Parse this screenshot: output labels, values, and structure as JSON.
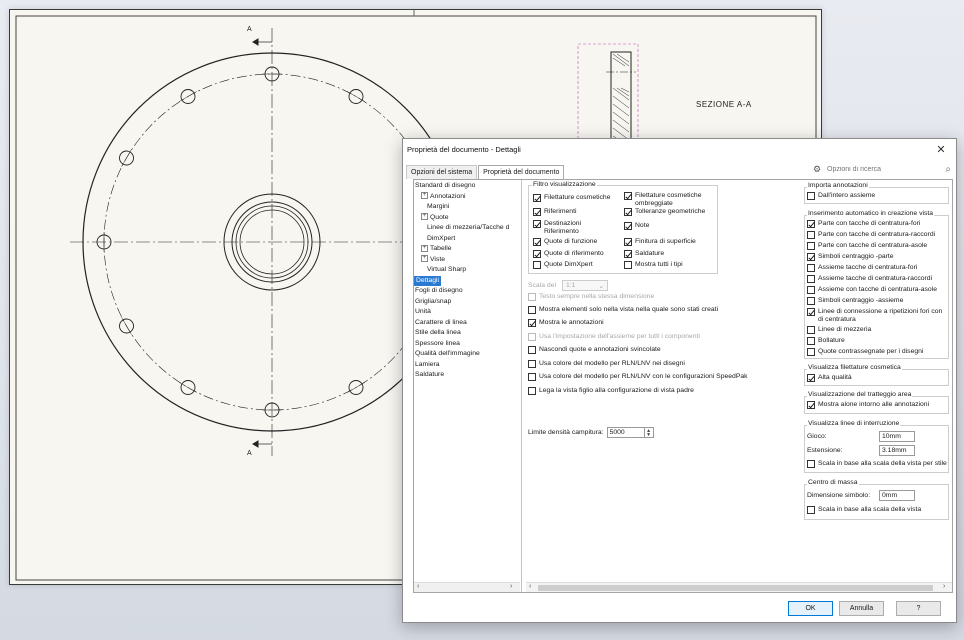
{
  "drawing": {
    "section_title": "SEZIONE A-A",
    "marker_top": "A",
    "marker_bottom": "A"
  },
  "dialog": {
    "title": "Proprietà del documento - Dettagli",
    "tabs": [
      "Opzioni del sistema",
      "Proprietà del documento"
    ],
    "search_placeholder": "Opzioni di ricerca",
    "tree": [
      {
        "label": "Standard di disegno",
        "indent": 0,
        "exp": ""
      },
      {
        "label": "Annotazioni",
        "indent": 1,
        "exp": "+"
      },
      {
        "label": "Margini",
        "indent": 2,
        "exp": ""
      },
      {
        "label": "Quote",
        "indent": 1,
        "exp": "+"
      },
      {
        "label": "Linee di mezzeria/Tacche d",
        "indent": 2,
        "exp": ""
      },
      {
        "label": "DimXpert",
        "indent": 2,
        "exp": ""
      },
      {
        "label": "Tabelle",
        "indent": 1,
        "exp": "+"
      },
      {
        "label": "Viste",
        "indent": 1,
        "exp": "+"
      },
      {
        "label": "Virtual Sharp",
        "indent": 2,
        "exp": ""
      },
      {
        "label": "Dettagli",
        "indent": 0,
        "exp": "",
        "selected": true
      },
      {
        "label": "Fogli di disegno",
        "indent": 0,
        "exp": ""
      },
      {
        "label": "Griglia/snap",
        "indent": 0,
        "exp": ""
      },
      {
        "label": "Unità",
        "indent": 0,
        "exp": ""
      },
      {
        "label": "Carattere di linea",
        "indent": 0,
        "exp": ""
      },
      {
        "label": "Stile della linea",
        "indent": 0,
        "exp": ""
      },
      {
        "label": "Spessore linea",
        "indent": 0,
        "exp": ""
      },
      {
        "label": "Qualità dell'immagine",
        "indent": 0,
        "exp": ""
      },
      {
        "label": "Lamiera",
        "indent": 0,
        "exp": ""
      },
      {
        "label": "Saldature",
        "indent": 0,
        "exp": ""
      }
    ],
    "filter_group": {
      "title": "Filtro visualizzazione",
      "left": [
        {
          "label": "Filettature cosmetiche",
          "checked": true
        },
        {
          "label": "Riferimenti",
          "checked": true
        },
        {
          "label": "Destinazioni\nRiferimento",
          "checked": true
        },
        {
          "label": "Quote di funzione",
          "checked": true
        },
        {
          "label": "Quote di riferimento",
          "checked": true
        },
        {
          "label": "Quote DimXpert",
          "checked": false
        }
      ],
      "right": [
        {
          "label": "Filettature cosmetiche\nombreggiate",
          "checked": true
        },
        {
          "label": "Tolleranze geometriche",
          "checked": true
        },
        {
          "label": "Note",
          "checked": true
        },
        {
          "label": "Finitura di superficie",
          "checked": true
        },
        {
          "label": "Saldature",
          "checked": true
        },
        {
          "label": "Mostra tutti i tipi",
          "checked": false
        }
      ]
    },
    "scale_label": "Scala del",
    "scale_value": "1:1",
    "options": [
      {
        "label": "Testo sempre nella stessa dimensione",
        "checked": false,
        "disabled": true
      },
      {
        "label": "Mostra elementi solo nella vista nella quale sono stati creati",
        "checked": false,
        "disabled": false
      },
      {
        "label": "Mostra le annotazioni",
        "checked": true,
        "disabled": false
      },
      {
        "label": "Usa l'impostazione dell'assieme per tutti i componenti",
        "checked": false,
        "disabled": true
      },
      {
        "label": "Nascondi quote e annotazioni svincolate",
        "checked": false,
        "disabled": false
      },
      {
        "label": "Usa colore del modello per RLN/LNV nei disegni",
        "checked": false,
        "disabled": false
      },
      {
        "label": "Usa colore del modello per RLN/LNV con le configurazioni SpeedPak",
        "checked": false,
        "disabled": false
      },
      {
        "label": "Lega la vista figlio alla configurazione di vista padre",
        "checked": false,
        "disabled": false
      }
    ],
    "hatch_limit_label": "Limite densità campitura:",
    "hatch_limit_value": "5000",
    "import_group": {
      "title": "Importa annotazioni",
      "items": [
        {
          "label": "Dall'intero assieme",
          "checked": false
        }
      ]
    },
    "auto_insert_group": {
      "title": "Inserimento automatico in creazione vista",
      "items": [
        {
          "label": "Parte con tacche di centratura-fori",
          "checked": true
        },
        {
          "label": "Parte con tacche di centratura-raccordi",
          "checked": false
        },
        {
          "label": "Parte con tacche di centratura-asole",
          "checked": false
        },
        {
          "label": "Simboli centraggio -parte",
          "checked": true
        },
        {
          "label": "Assieme tacche di centratura-fori",
          "checked": false
        },
        {
          "label": "Assieme tacche di centratura-raccordi",
          "checked": false
        },
        {
          "label": "Assieme con tacche di centratura-asole",
          "checked": false
        },
        {
          "label": "Simboli centraggio -assieme",
          "checked": false
        },
        {
          "label": "Linee di connessione a ripetizioni fori con\ndi centratura",
          "checked": true
        },
        {
          "label": "Linee di mezzeria",
          "checked": false
        },
        {
          "label": "Bollature",
          "checked": false
        },
        {
          "label": "Quote contrassegnate per i disegni",
          "checked": false
        }
      ]
    },
    "cosmetic_group": {
      "title": "Visualizza filettature cosmetica",
      "items": [
        {
          "label": "Alta qualità",
          "checked": true
        }
      ]
    },
    "hatch_group": {
      "title": "Visualizzazione del tratteggio area",
      "items": [
        {
          "label": "Mostra alone intorno alle annotazioni",
          "checked": true
        }
      ]
    },
    "break_group": {
      "title": "Visualizza linee di interruzione",
      "gap_label": "Gioco:",
      "gap_value": "10mm",
      "extension_label": "Estensione:",
      "extension_value": "3.18mm",
      "scale_item": {
        "label": "Scala in base alla scala della vista per stile",
        "checked": false
      }
    },
    "mass_group": {
      "title": "Centro di massa",
      "symbol_label": "Dimensione simbolo:",
      "symbol_value": "0mm",
      "scale_item": {
        "label": "Scala in base alla scala della vista",
        "checked": false
      }
    },
    "buttons": {
      "ok": "OK",
      "cancel": "Annulla",
      "help": "?"
    }
  }
}
